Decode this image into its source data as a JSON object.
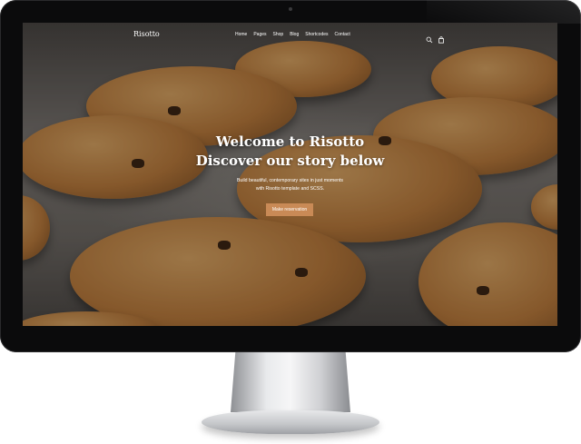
{
  "nav": {
    "logo": "Risotto",
    "items": [
      "Home",
      "Pages",
      "Shop",
      "Blog",
      "Shortcodes",
      "Contact"
    ],
    "icons": [
      "search-icon",
      "shopping-bag-icon"
    ]
  },
  "hero": {
    "title_line1": "Welcome to Risotto",
    "title_line2": "Discover our story below",
    "subtitle_line1": "Build beautiful, contemporary sites in just moments",
    "subtitle_line2": "with Risotto template and SCSS.",
    "cta_label": "Make reservation"
  },
  "colors": {
    "accent": "#c98a56",
    "bezel": "#0b0b0c"
  }
}
